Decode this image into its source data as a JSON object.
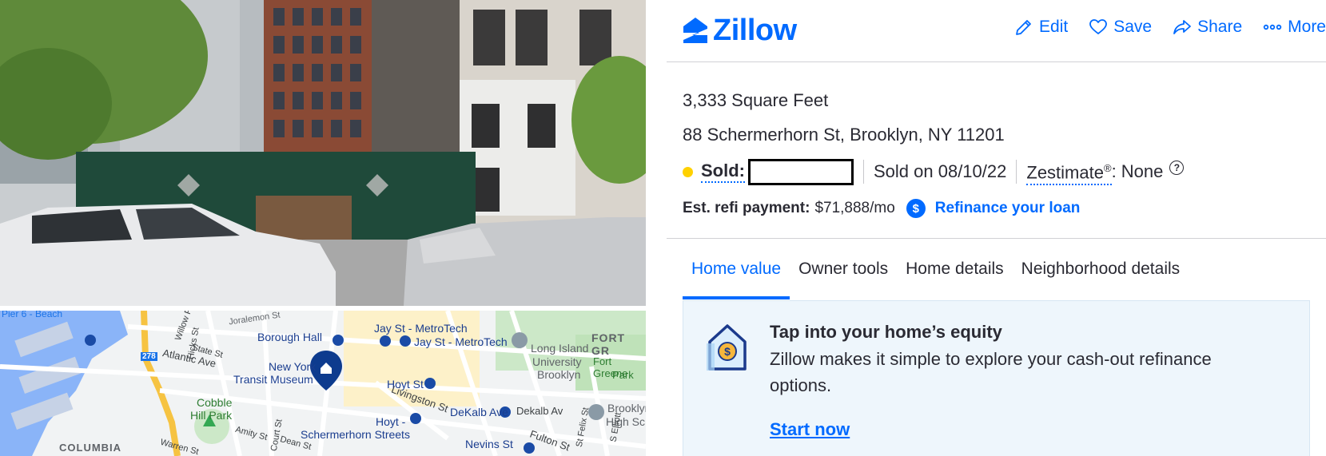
{
  "header": {
    "logo_text": "Zillow",
    "actions": [
      {
        "label": "Edit",
        "icon": "pencil-icon"
      },
      {
        "label": "Save",
        "icon": "heart-icon"
      },
      {
        "label": "Share",
        "icon": "share-icon"
      },
      {
        "label": "More",
        "icon": "more-dots-icon"
      }
    ]
  },
  "property": {
    "size": "3,333 Square Feet",
    "address": "88 Schermerhorn St, Brooklyn, NY 11201",
    "sold_label": "Sold:",
    "sold_date": "Sold on 08/10/22",
    "zestimate_label": "Zestimate",
    "zestimate_mark": "®",
    "zestimate_value": ": None",
    "help_glyph": "?",
    "refi_label": "Est. refi payment:",
    "refi_value": "$71,888/mo",
    "refi_coin": "$",
    "refi_link": "Refinance your loan"
  },
  "tabs": [
    {
      "label": "Home value",
      "active": true
    },
    {
      "label": "Owner tools",
      "active": false
    },
    {
      "label": "Home details",
      "active": false
    },
    {
      "label": "Neighborhood details",
      "active": false
    }
  ],
  "promo": {
    "title": "Tap into your home’s equity",
    "body": "Zillow makes it simple to explore your cash-out refinance options.",
    "cta": "Start now"
  },
  "map": {
    "labels": [
      "Joralemon St",
      "Borough Hall",
      "Jay St - MetroTech",
      "Jay St - MetroTech",
      "FORT GR",
      "Long Island",
      "University",
      "Brooklyn",
      "Fort Greene",
      "Park",
      "Atlantic Ave",
      "New York",
      "Transit Museum",
      "Hoyt St",
      "Livingston St",
      "DeKalb Ave",
      "Dekalb Av",
      "Brooklyn",
      "High Sc",
      "Cobble",
      "Hill Park",
      "Hoyt -",
      "Schermerhorn Streets",
      "Nevins St",
      "Fulton St",
      "COLUMBIA",
      "Court St",
      "Dean St",
      "Amity St",
      "Warren St",
      "State St",
      "Hicks St",
      "Willow Pl",
      "Pier 6 - Beach",
      "278",
      "St Felix St",
      "S Elliott"
    ]
  },
  "colors": {
    "brand": "#006aff",
    "sold_dot": "#ffd100",
    "promo_bg": "#eef6fc"
  }
}
